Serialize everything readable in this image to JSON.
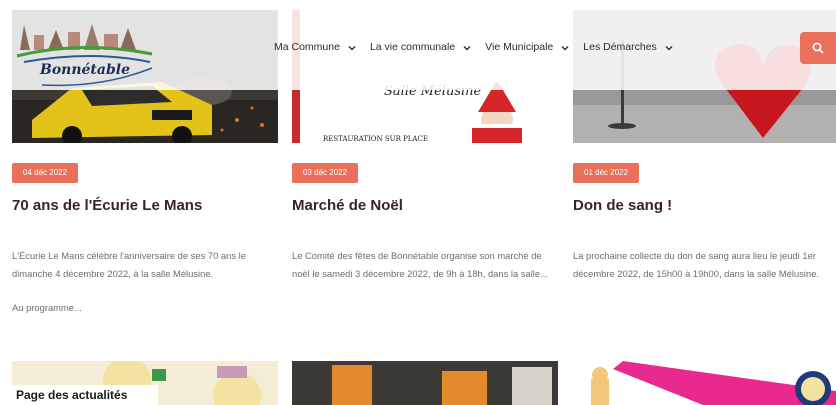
{
  "header": {
    "logo_text": "Bonnétable",
    "nav": [
      {
        "label": "Ma Commune"
      },
      {
        "label": "La vie communale"
      },
      {
        "label": "Vie Municipale"
      },
      {
        "label": "Les Démarches"
      }
    ],
    "search_icon": "search-icon"
  },
  "cards": [
    {
      "date": "04 déc 2022",
      "title": "70 ans de l'Écurie Le Mans",
      "excerpt": "L'Écurie Le Mans célèbre l'anniversaire de ses 70 ans le dimanche 4 décembre 2022, à la salle Mélusine.",
      "more": "Au programme..."
    },
    {
      "date": "03 déc 2022",
      "title": "Marché de Noël",
      "excerpt": "Le Comité des fêtes de Bonnétable organise son marché de noël le samedi 3 décembre 2022, de 9h à 18h, dans la salle...",
      "image_text_1": "Salle Mélusine",
      "image_text_2": "RESTAURATION SUR PLACE"
    },
    {
      "date": "01 déc 2022",
      "title": "Don de sang !",
      "excerpt": "La prochaine collecte du don de sang aura lieu le jeudi 1er décembre 2022, de 15h00 à 19h00, dans la salle Mélusine."
    }
  ],
  "caption": "Page des actualités",
  "colors": {
    "accent": "#e9705a",
    "title": "#3b2424",
    "text": "#6e6e6e"
  }
}
